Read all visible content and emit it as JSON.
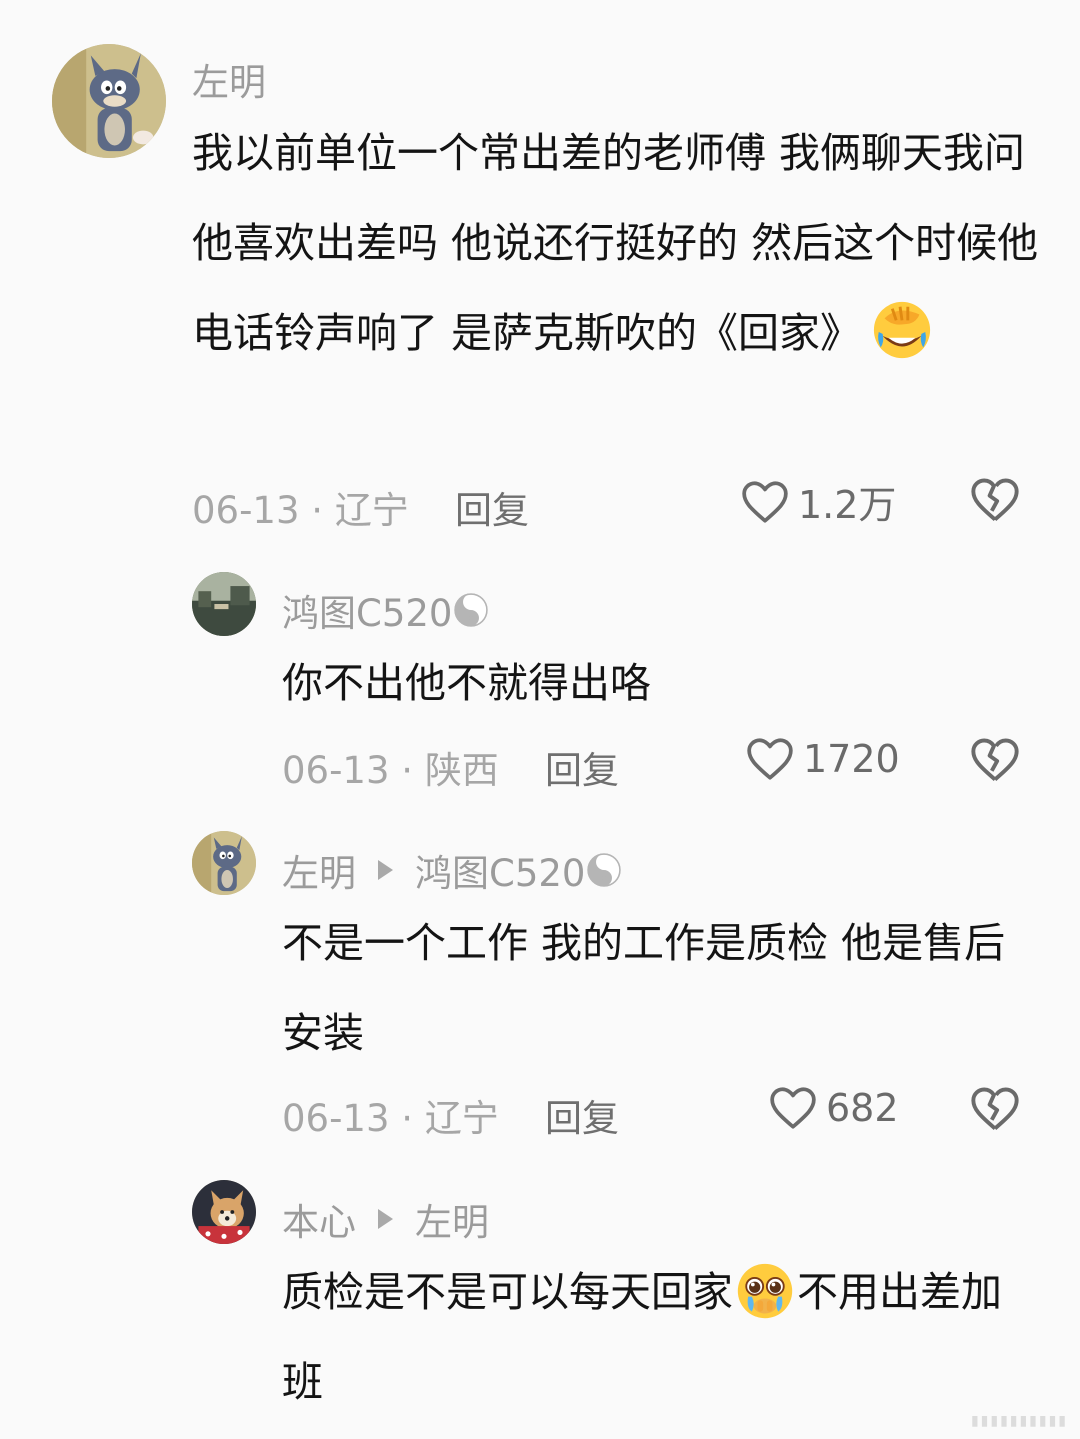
{
  "comments": [
    {
      "user": "左明",
      "text": "我以前单位一个常出差的老师傅  我俩聊天我问他喜欢出差吗  他说还行挺好的  然后这个时候他电话铃声响了  是萨克斯吹的《回家》",
      "emoji": "facepalm-laughing-emoji",
      "date": "06-13",
      "location": "辽宁",
      "reply_label": "回复",
      "likes": "1.2万"
    },
    {
      "user": "鸿图C520",
      "text": "你不出他不就得出咯",
      "date": "06-13",
      "location": "陕西",
      "reply_label": "回复",
      "likes": "1720"
    },
    {
      "user": "左明",
      "reply_to": "鸿图C520",
      "text": "不是一个工作  我的工作是质检  他是售后安装",
      "date": "06-13",
      "location": "辽宁",
      "reply_label": "回复",
      "likes": "682"
    },
    {
      "user": "本心",
      "reply_to": "左明",
      "text_before": "质检是不是可以每天回家",
      "emoji": "pleading-crying-emoji",
      "text_after": "不用出差加班"
    }
  ],
  "meta_sep": " · ",
  "colors": {
    "username": "#9b9b9b",
    "body": "#141414",
    "meta": "#a6a6a6",
    "background": "#fafafa"
  }
}
